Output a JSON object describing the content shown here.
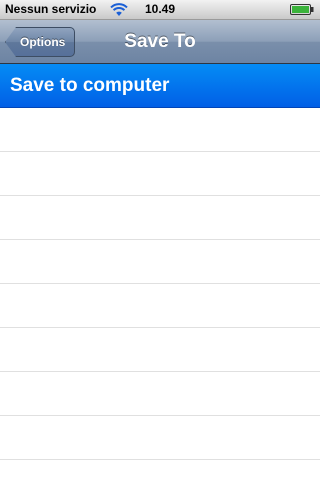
{
  "status_bar": {
    "carrier": "Nessun servizio",
    "time": "10.49",
    "wifi_icon": "wifi-icon",
    "battery_icon": "battery-icon"
  },
  "nav_bar": {
    "back_label": "Options",
    "title": "Save To"
  },
  "table": {
    "rows": [
      {
        "label": "Save to computer",
        "selected": true
      },
      {
        "label": ""
      },
      {
        "label": ""
      },
      {
        "label": ""
      },
      {
        "label": ""
      },
      {
        "label": ""
      },
      {
        "label": ""
      },
      {
        "label": ""
      },
      {
        "label": ""
      },
      {
        "label": ""
      }
    ],
    "selection_color": "#0a6ff0"
  }
}
